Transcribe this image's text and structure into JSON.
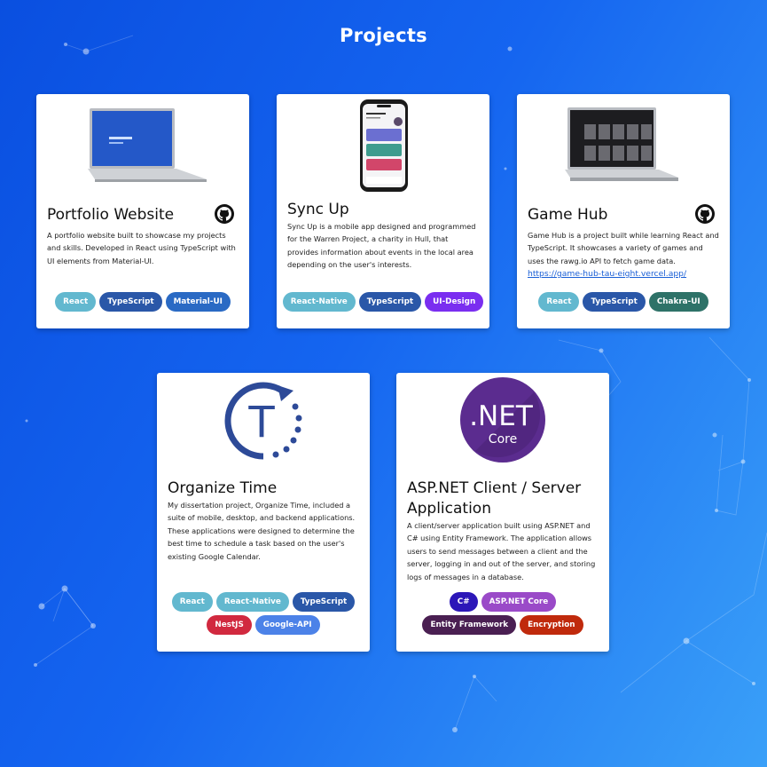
{
  "page": {
    "title": "Projects"
  },
  "colors": {
    "react": "#62b8cf",
    "typescript": "#2a57a8",
    "material_ui": "#2a6ac4",
    "react_native": "#62b8cf",
    "ui_design": "#7a2ef0",
    "chakra": "#2e7268",
    "nestjs": "#d1293f",
    "google_api": "#4c82e8",
    "csharp": "#2c17b8",
    "aspnet_core": "#9a4ac8",
    "entity_framework": "#4a1f52",
    "encryption": "#c02a0c"
  },
  "projects": [
    {
      "title": "Portfolio Website",
      "description": "A portfolio website built to showcase my projects and skills. Developed in React using TypeScript with UI elements from Material-UI.",
      "tags": [
        "React",
        "TypeScript",
        "Material-UI"
      ],
      "image_icon": "laptop-icon"
    },
    {
      "title": "Sync Up",
      "description": "Sync Up is a mobile app designed and programmed for the Warren Project, a charity in Hull, that provides information about events in the local area depending on the user's interests.",
      "tags": [
        "React-Native",
        "TypeScript",
        "UI-Design"
      ],
      "image_icon": "phone-icon"
    },
    {
      "title": "Game Hub",
      "description": "Game Hub is a project built while learning React and TypeScript. It showcases a variety of games and uses the rawg.io API to fetch game data.",
      "link": "https://game-hub-tau-eight.vercel.app/",
      "tags": [
        "React",
        "TypeScript",
        "Chakra-UI"
      ],
      "image_icon": "laptop-icon"
    },
    {
      "title": "Organize Time",
      "description": "My dissertation project, Organize Time, included a suite of mobile, desktop, and backend applications. These applications were designed to determine the best time to schedule a task based on the user's existing Google Calendar.",
      "tags": [
        "React",
        "React-Native",
        "TypeScript",
        "NestJS",
        "Google-API"
      ],
      "logo_letter": "T"
    },
    {
      "title": "ASP.NET Client / Server Application",
      "description": "A client/server application built using ASP.NET and C# using Entity Framework. The application allows users to send messages between a client and the server, logging in and out of the server, and storing logs of messages in a database.",
      "tags": [
        "C#",
        "ASP.NET Core",
        "Entity Framework",
        "Encryption"
      ],
      "logo_text": ".NET",
      "logo_subtext": "Core"
    }
  ]
}
